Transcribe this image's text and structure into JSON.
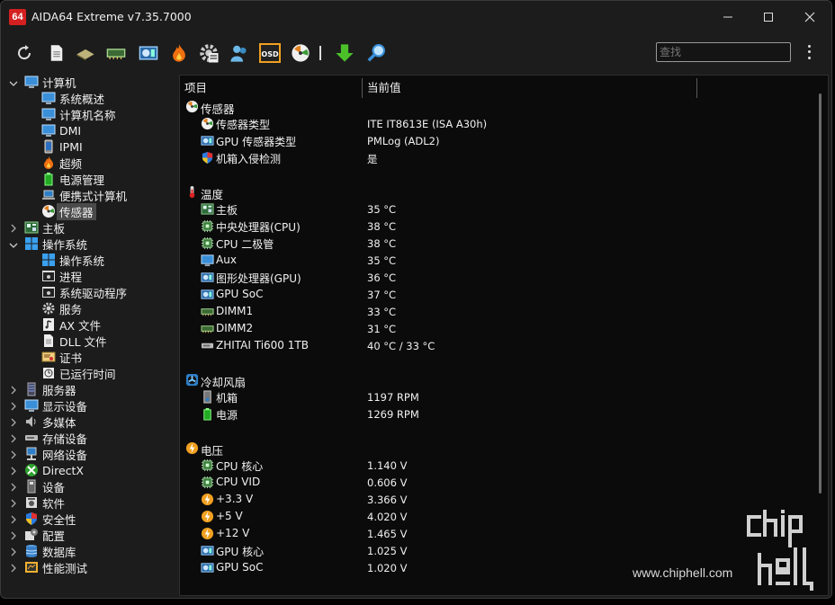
{
  "window": {
    "app_logo": "64",
    "title": "AIDA64 Extreme v7.35.7000"
  },
  "search": {
    "placeholder": "查找"
  },
  "toolbar": {
    "icons": [
      "refresh-icon",
      "report-icon",
      "motherboard-icon",
      "memory-icon",
      "network-icon",
      "flame-icon",
      "system-settings-icon",
      "user-icon",
      "osd-icon",
      "sensor-gauge-icon",
      "download-icon",
      "search-icon"
    ]
  },
  "tree": {
    "computer": "计算机",
    "computer_children": [
      "系统概述",
      "计算机名称",
      "DMI",
      "IPMI",
      "超频",
      "电源管理",
      "便携式计算机",
      "传感器"
    ],
    "motherboard": "主板",
    "os": "操作系统",
    "os_children": [
      "操作系统",
      "进程",
      "系统驱动程序",
      "服务",
      "AX 文件",
      "DLL 文件",
      "证书",
      "已运行时间"
    ],
    "others": [
      "服务器",
      "显示设备",
      "多媒体",
      "存储设备",
      "网络设备",
      "DirectX",
      "设备",
      "软件",
      "安全性",
      "配置",
      "数据库",
      "性能测试"
    ]
  },
  "columns": {
    "item": "项目",
    "value": "当前值"
  },
  "groups": {
    "sensor": {
      "title": "传感器",
      "rows": [
        {
          "name": "传感器类型",
          "value": "ITE IT8613E  (ISA A30h)"
        },
        {
          "name": "GPU 传感器类型",
          "value": "PMLog  (ADL2)"
        },
        {
          "name": "机箱入侵检测",
          "value": "是"
        }
      ]
    },
    "temp": {
      "title": "温度",
      "rows": [
        {
          "name": "主板",
          "value": "35 °C"
        },
        {
          "name": "中央处理器(CPU)",
          "value": "38 °C"
        },
        {
          "name": "CPU 二极管",
          "value": "38 °C"
        },
        {
          "name": "Aux",
          "value": "35 °C"
        },
        {
          "name": "图形处理器(GPU)",
          "value": "36 °C"
        },
        {
          "name": "GPU SoC",
          "value": "37 °C"
        },
        {
          "name": "DIMM1",
          "value": "33 °C"
        },
        {
          "name": "DIMM2",
          "value": "31 °C"
        },
        {
          "name": "ZHITAI Ti600 1TB",
          "value": "40 °C / 33 °C"
        }
      ]
    },
    "fan": {
      "title": "冷却风扇",
      "rows": [
        {
          "name": "机箱",
          "value": "1197 RPM"
        },
        {
          "name": "电源",
          "value": "1269 RPM"
        }
      ]
    },
    "volt": {
      "title": "电压",
      "rows": [
        {
          "name": "CPU 核心",
          "value": "1.140 V"
        },
        {
          "name": "CPU VID",
          "value": "0.606 V"
        },
        {
          "name": "+3.3 V",
          "value": "3.366 V"
        },
        {
          "name": "+5 V",
          "value": "4.020 V"
        },
        {
          "name": "+12 V",
          "value": "1.465 V"
        },
        {
          "name": "GPU 核心",
          "value": "1.025 V"
        },
        {
          "name": "GPU SoC",
          "value": "1.020 V"
        }
      ]
    }
  },
  "watermark": {
    "url": "www.chiphell.com",
    "logo_text": "chip hell"
  },
  "colors": {
    "accent_red": "#d42020",
    "selected_bg": "#4a4a4a",
    "list_bg": "#0b0b0b"
  }
}
